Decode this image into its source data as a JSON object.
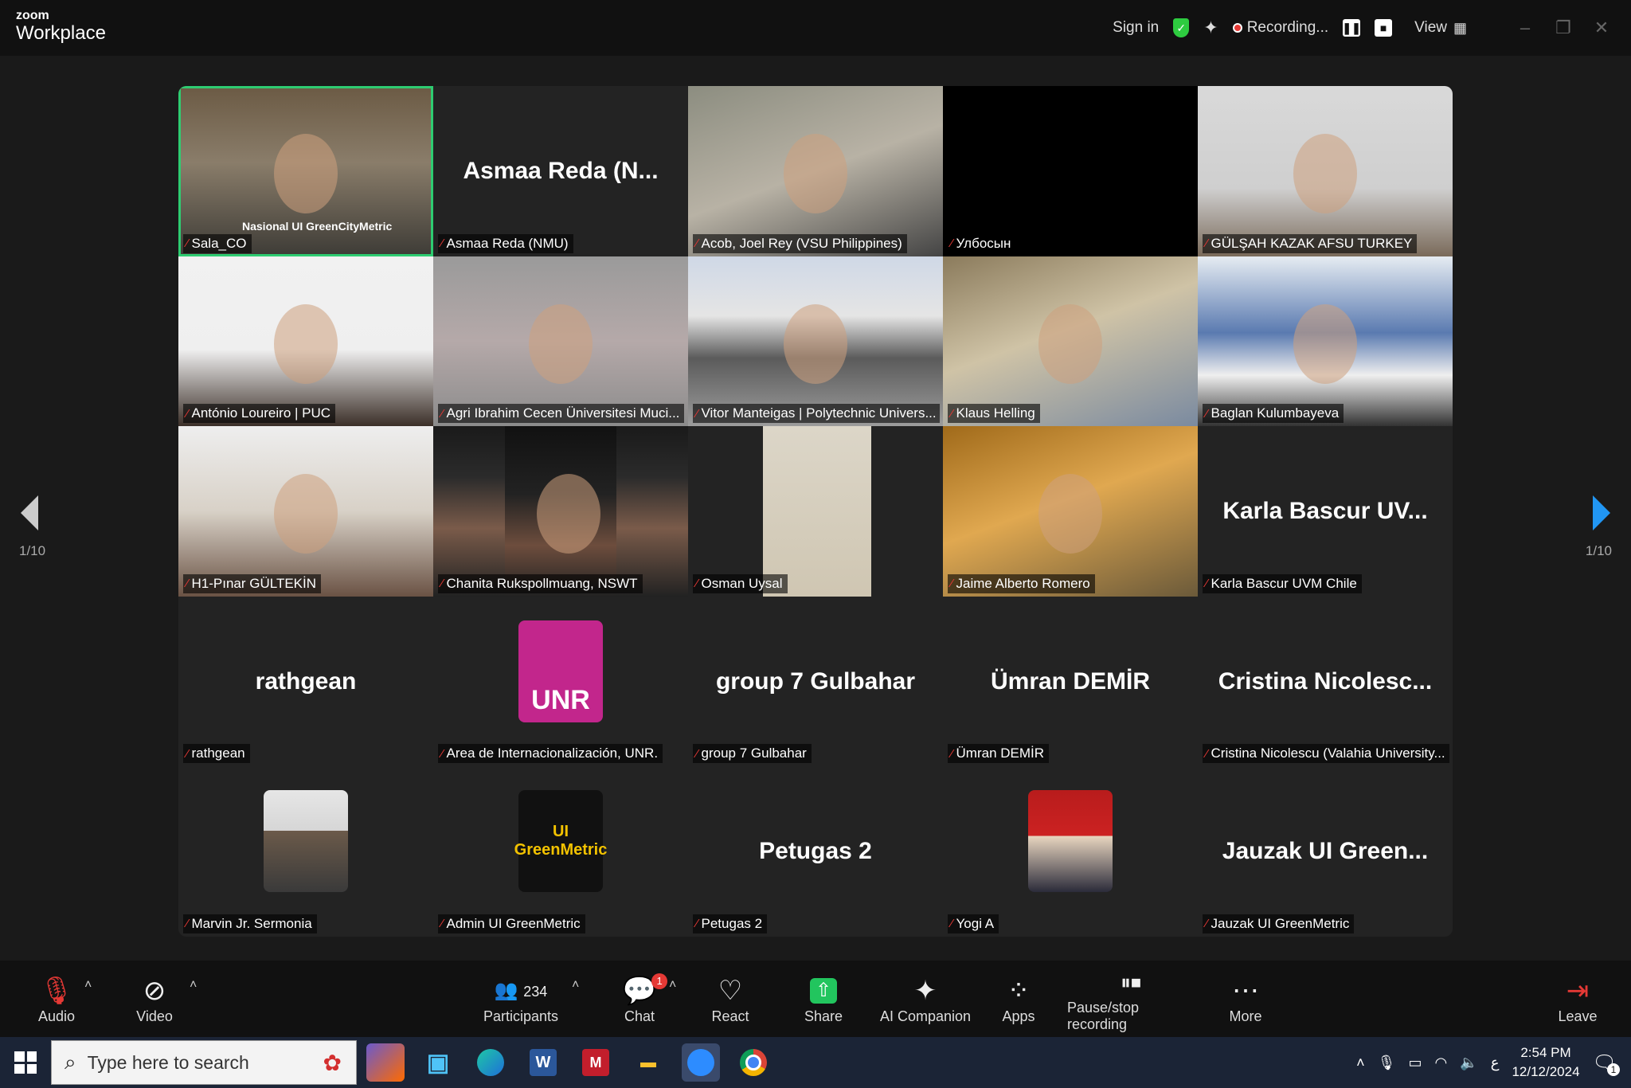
{
  "app": {
    "brand_small": "zoom",
    "brand": "Workplace"
  },
  "titlebar": {
    "sign_in": "Sign in",
    "recording": "Recording...",
    "view": "View"
  },
  "tiles": [
    {
      "label": "Sala_CO",
      "name": "",
      "type": "video"
    },
    {
      "label": "Asmaa Reda (NMU)",
      "name": "Asmaa Reda (N...",
      "type": "name"
    },
    {
      "label": "Acob, Joel Rey (VSU Philippines)",
      "name": "",
      "type": "video"
    },
    {
      "label": "Улбосын",
      "name": "",
      "type": "blank"
    },
    {
      "label": "GÜLŞAH KAZAK AFSU TURKEY",
      "name": "",
      "type": "video"
    },
    {
      "label": "António Loureiro | PUC",
      "name": "",
      "type": "video"
    },
    {
      "label": "Agri Ibrahim Cecen Üniversitesi Muci...",
      "name": "",
      "type": "video"
    },
    {
      "label": "Vitor Manteigas | Polytechnic Univers...",
      "name": "",
      "type": "video"
    },
    {
      "label": "Klaus Helling",
      "name": "",
      "type": "video"
    },
    {
      "label": "Baglan Kulumbayeva",
      "name": "",
      "type": "video"
    },
    {
      "label": "H1-Pınar GÜLTEKİN",
      "name": "",
      "type": "video"
    },
    {
      "label": "Chanita Rukspollmuang, NSWT",
      "name": "",
      "type": "video"
    },
    {
      "label": "Osman Uysal",
      "name": "",
      "type": "video"
    },
    {
      "label": "Jaime Alberto Romero",
      "name": "",
      "type": "video"
    },
    {
      "label": "Karla Bascur UVM Chile",
      "name": "Karla Bascur UV...",
      "type": "name"
    },
    {
      "label": "rathgean",
      "name": "rathgean",
      "type": "name"
    },
    {
      "label": "Area de Internacionalización, UNR.",
      "name": "",
      "type": "avatar-unr",
      "avatar_text": "UNR"
    },
    {
      "label": "group 7 Gulbahar",
      "name": "group 7 Gulbahar",
      "type": "name"
    },
    {
      "label": "Ümran DEMİR",
      "name": "Ümran DEMİR",
      "type": "name"
    },
    {
      "label": "Cristina Nicolescu (Valahia University...",
      "name": "Cristina Nicolesc...",
      "type": "name"
    },
    {
      "label": "Marvin Jr. Sermonia",
      "name": "",
      "type": "avatar-photo"
    },
    {
      "label": "Admin UI GreenMetric",
      "name": "",
      "type": "avatar-ui",
      "avatar_text": "UI GreenMetric"
    },
    {
      "label": "Petugas 2",
      "name": "Petugas 2",
      "type": "name"
    },
    {
      "label": "Yogi A",
      "name": "",
      "type": "avatar-photo2"
    },
    {
      "label": "Jauzak UI GreenMetric",
      "name": "Jauzak UI Green...",
      "type": "name"
    }
  ],
  "overlay_text": {
    "video_banner": "Nasional UI GreenCityMetric"
  },
  "pagination": {
    "left": "1/10",
    "right": "1/10"
  },
  "toolbar": {
    "audio": "Audio",
    "video": "Video",
    "participants": "Participants",
    "participants_count": "234",
    "chat": "Chat",
    "chat_badge": "1",
    "react": "React",
    "share": "Share",
    "ai_companion": "AI Companion",
    "apps": "Apps",
    "pause_stop": "Pause/stop recording",
    "more": "More",
    "leave": "Leave"
  },
  "taskbar": {
    "search_placeholder": "Type here to search",
    "time": "2:54 PM",
    "date": "12/12/2024",
    "notif_count": "1",
    "lang": "ع"
  },
  "colors": {
    "active_tile": "#2ecc71",
    "share": "#22c55e",
    "badge": "#e53935",
    "unr": "#c2268c",
    "next_arrow": "#2196f3"
  }
}
